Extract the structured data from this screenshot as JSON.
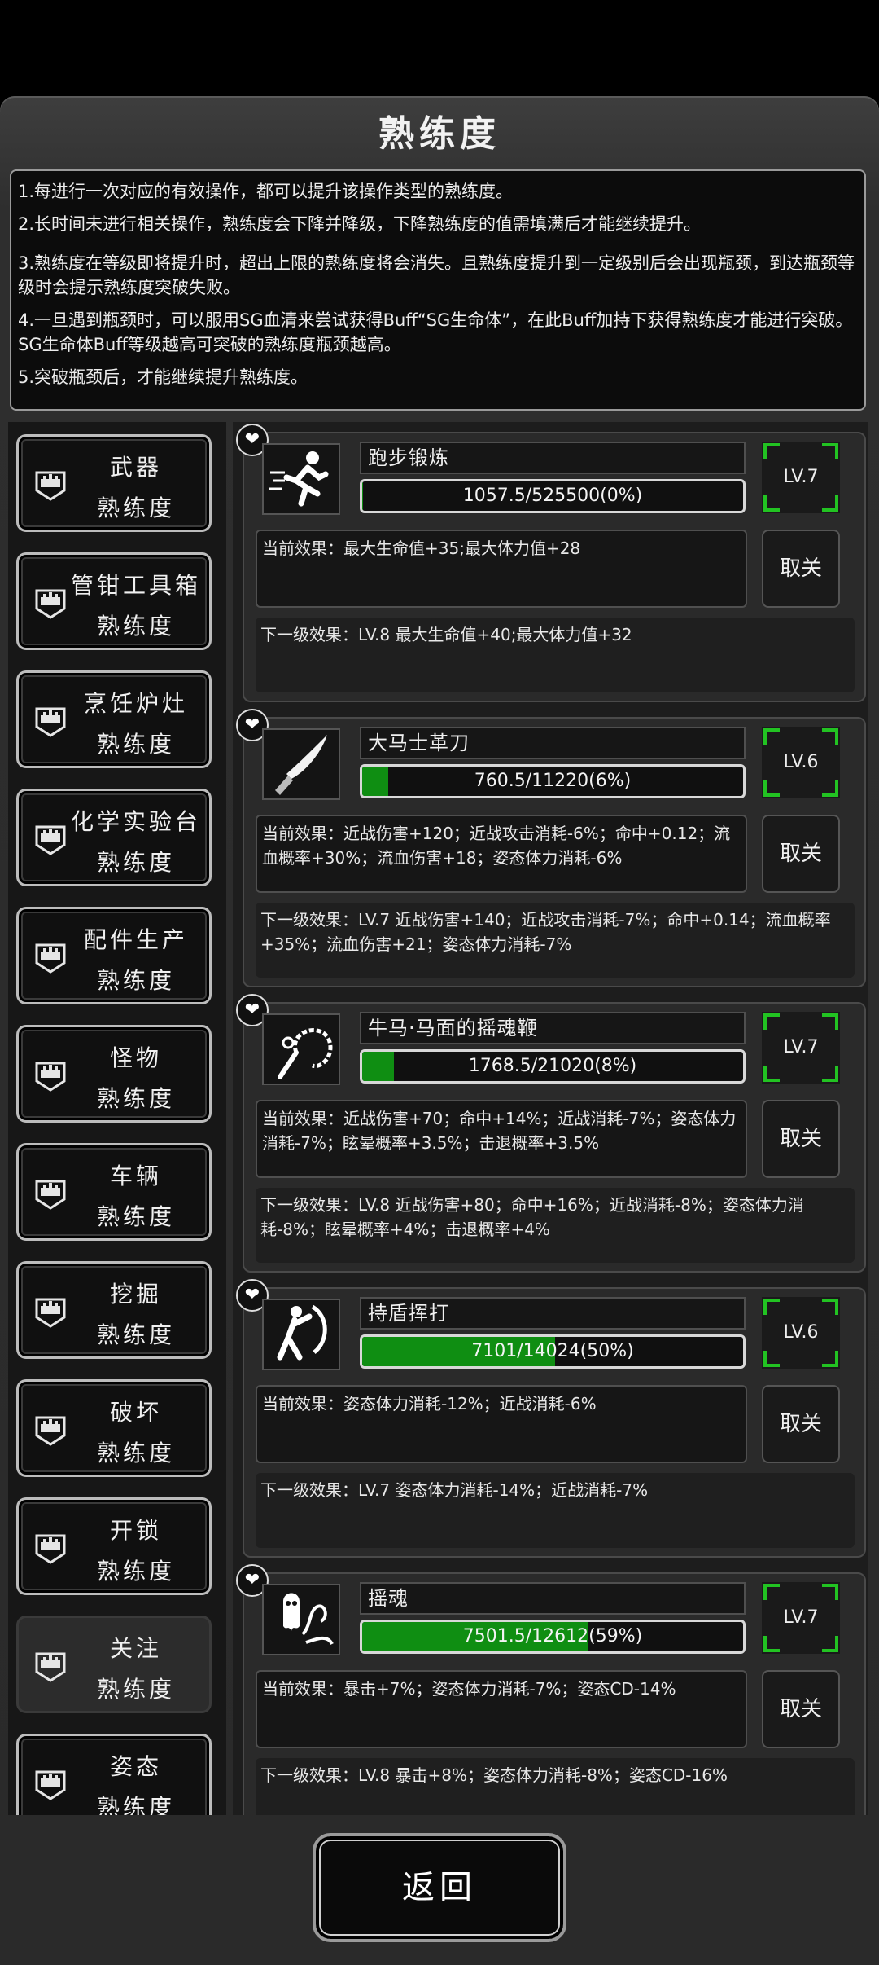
{
  "title": "熟练度",
  "description": [
    "1.每进行一次对应的有效操作，都可以提升该操作类型的熟练度。",
    "2.长时间未进行相关操作，熟练度会下降并降级，下降熟练度的值需填满后才能继续提升。",
    "3.熟练度在等级即将提升时，超出上限的熟练度将会消失。且熟练度提升到一定级别后会出现瓶颈，到达瓶颈等级时会提示熟练度突破失败。",
    "4.一旦遇到瓶颈时，可以服用SG血清来尝试获得Buff“SG生命体”，在此Buff加持下获得熟练度才能进行突破。SG生命体Buff等级越高可突破的熟练度瓶颈越高。",
    "5.突破瓶颈后，才能继续提升熟练度。"
  ],
  "categories": [
    {
      "line1": "武器",
      "line2": "熟练度"
    },
    {
      "line1": "管钳工具箱",
      "line2": "熟练度"
    },
    {
      "line1": "烹饪炉灶",
      "line2": "熟练度"
    },
    {
      "line1": "化学实验台",
      "line2": "熟练度"
    },
    {
      "line1": "配件生产",
      "line2": "熟练度"
    },
    {
      "line1": "怪物",
      "line2": "熟练度"
    },
    {
      "line1": "车辆",
      "line2": "熟练度"
    },
    {
      "line1": "挖掘",
      "line2": "熟练度"
    },
    {
      "line1": "破坏",
      "line2": "熟练度"
    },
    {
      "line1": "开锁",
      "line2": "熟练度"
    },
    {
      "line1": "关注",
      "line2": "熟练度"
    },
    {
      "line1": "姿态",
      "line2": "熟练度"
    }
  ],
  "active_category": 10,
  "skills": [
    {
      "name": "跑步锻炼",
      "icon": "running-man-icon",
      "progress_text": "1057.5/525500(0%)",
      "progress": 0.002,
      "level": "LV.7",
      "current_effect": "当前效果：最大生命值+35;最大体力值+28",
      "cancel_label": "取关",
      "next_effect": "下一级效果：LV.8 最大生命值+40;最大体力值+32"
    },
    {
      "name": "大马士革刀",
      "icon": "knife-icon",
      "progress_text": "760.5/11220(6%)",
      "progress": 0.068,
      "level": "LV.6",
      "current_effect": "当前效果：近战伤害+120；近战攻击消耗-6%；命中+0.12；流血概率+30%；流血伤害+18；姿态体力消耗-6%",
      "cancel_label": "取关",
      "next_effect": "下一级效果：LV.7 近战伤害+140；近战攻击消耗-7%；命中+0.14；流血概率+35%；流血伤害+21；姿态体力消耗-7%"
    },
    {
      "name": "牛马·马面的摇魂鞭",
      "icon": "whip-icon",
      "progress_text": "1768.5/21020(8%)",
      "progress": 0.084,
      "level": "LV.7",
      "current_effect": "当前效果：近战伤害+70；命中+14%；近战消耗-7%；姿态体力消耗-7%；眩晕概率+3.5%；击退概率+3.5%",
      "cancel_label": "取关",
      "next_effect": "下一级效果：LV.8 近战伤害+80；命中+16%；近战消耗-8%；姿态体力消耗-8%；眩晕概率+4%；击退概率+4%"
    },
    {
      "name": "持盾挥打",
      "icon": "shield-strike-icon",
      "progress_text": "7101/14024(50%)",
      "progress": 0.506,
      "level": "LV.6",
      "current_effect": "当前效果：姿态体力消耗-12%；近战消耗-6%",
      "cancel_label": "取关",
      "next_effect": "下一级效果：LV.7 姿态体力消耗-14%；近战消耗-7%"
    },
    {
      "name": "摇魂",
      "icon": "ghost-icon",
      "progress_text": "7501.5/12612(59%)",
      "progress": 0.595,
      "level": "LV.7",
      "current_effect": "当前效果：暴击+7%；姿态体力消耗-7%；姿态CD-14%",
      "cancel_label": "取关",
      "next_effect": "下一级效果：LV.8 暴击+8%；姿态体力消耗-8%；姿态CD-16%"
    }
  ],
  "back_label": "返回",
  "colors": {
    "progress_fill": "#0f8e12",
    "level_corner": "#22c322"
  }
}
